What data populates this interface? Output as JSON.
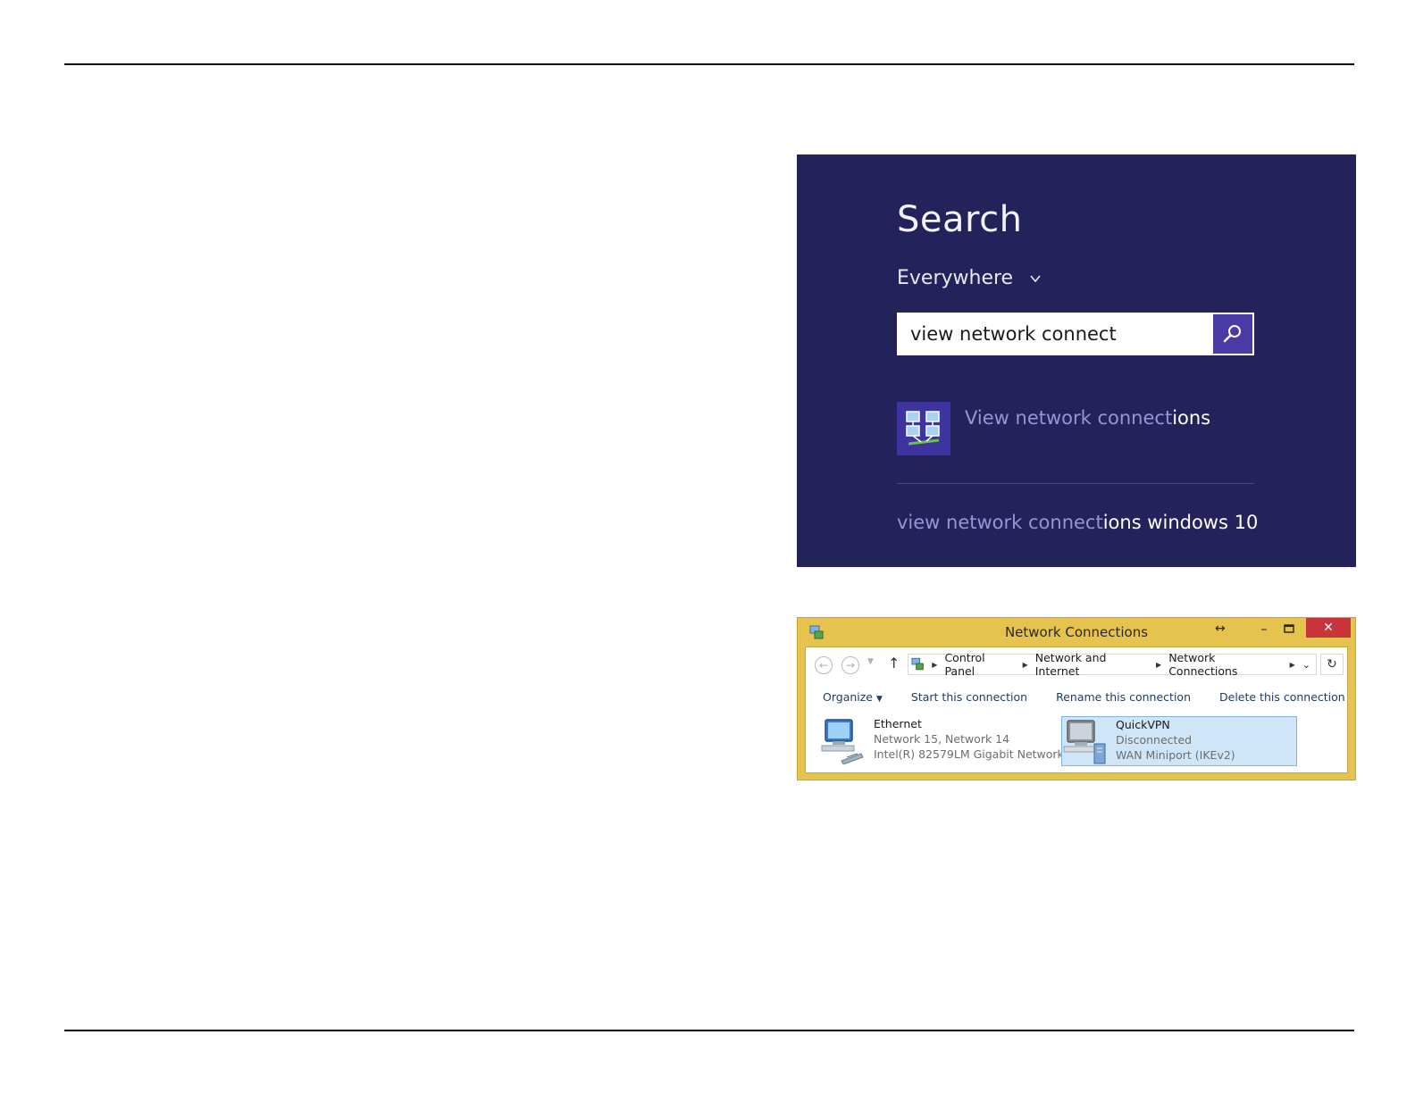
{
  "search_panel": {
    "title": "Search",
    "scope": "Everywhere",
    "query": "view network connect",
    "app_result": {
      "label_typed": "View network connect",
      "label_completion": "ions"
    },
    "suggestion": {
      "typed": "view network connect",
      "completion": "ions windows 10"
    },
    "colors": {
      "background": "#24225a",
      "accent": "#4a3aa6"
    }
  },
  "network_window": {
    "title": "Network Connections",
    "resize_glyph": "↔",
    "minimize": "–",
    "close": "✕",
    "breadcrumbs": [
      "Control Panel",
      "Network and Internet",
      "Network Connections"
    ],
    "commands": {
      "organize": "Organize",
      "start": "Start this connection",
      "rename": "Rename this connection",
      "delete": "Delete this connection"
    },
    "connections": [
      {
        "name": "Ethernet",
        "line1": "Network  15, Network  14",
        "line2": "Intel(R) 82579LM Gigabit Network..."
      },
      {
        "name": "QuickVPN",
        "line1": "Disconnected",
        "line2": "WAN Miniport (IKEv2)"
      }
    ],
    "colors": {
      "titlebar": "#e6c24e",
      "close": "#c7343a",
      "selection": "#cfe6f8"
    }
  }
}
